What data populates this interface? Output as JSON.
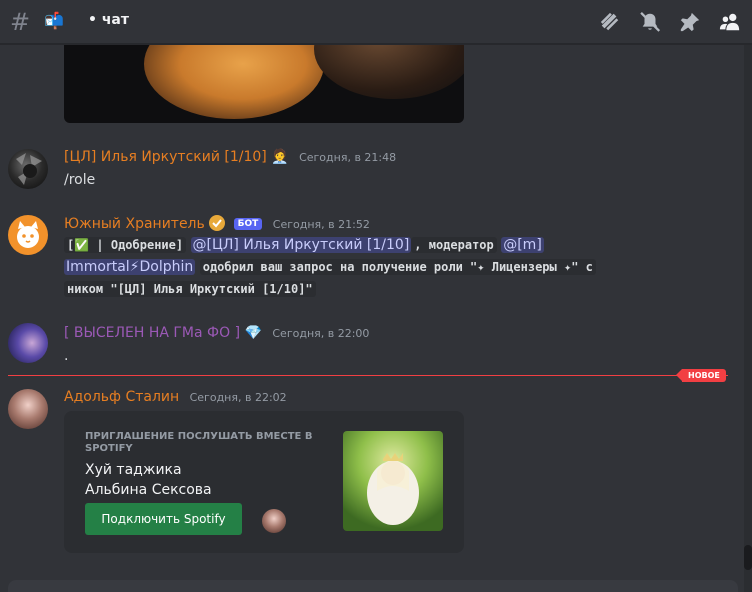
{
  "header": {
    "channel_emoji": "📬",
    "channel_name": "• чат",
    "icons": [
      "threads-icon",
      "mute-icon",
      "pin-icon",
      "members-icon"
    ]
  },
  "messages": [
    {
      "author": "[ЦЛ] Илья Иркутский [1/10]",
      "author_color": "#e67e22",
      "badge_emoji": "🧑‍💼",
      "timestamp": "Сегодня, в 21:48",
      "text": "/role"
    },
    {
      "author": "Южный Хранитель",
      "author_color": "#e67e22",
      "verified": true,
      "bot_tag": "БОТ",
      "timestamp": "Сегодня, в 21:52",
      "code_part1": "[✅ | Одобрение]",
      "mention1": "@[ЦЛ] Илья Иркутский [1/10]",
      "code_part2": ", модератор",
      "mention2a": "@[m]",
      "mention2b": "Immortal⚡Dolphin",
      "code_part3": "одобрил ваш запрос на получение роли \"✦ Лицензеры ✦\" с",
      "code_part4": "ником \"[ЦЛ] Илья Иркутский [1/10]\""
    },
    {
      "author": "[ ВЫСЕЛЕН  НА ГМа ФО ]",
      "author_color": "#9b59b6",
      "badge_emoji": "💎",
      "timestamp": "Сегодня, в 22:00",
      "text": "."
    },
    {
      "author": "Адольф Сталин",
      "author_color": "#e67e22",
      "timestamp": "Сегодня, в 22:02",
      "spotify": {
        "label": "ПРИГЛАШЕНИЕ ПОСЛУШАТЬ ВМЕСТЕ В SPOTIFY",
        "track": "Хуй таджика",
        "artist": "Альбина Сексова",
        "button": "Подключить Spotify"
      }
    }
  ],
  "new_divider": "НОВОЕ",
  "colors": {
    "background": "#313338",
    "accent": "#5865f2",
    "spotify_green": "#248046",
    "new_red": "#f23f43"
  }
}
